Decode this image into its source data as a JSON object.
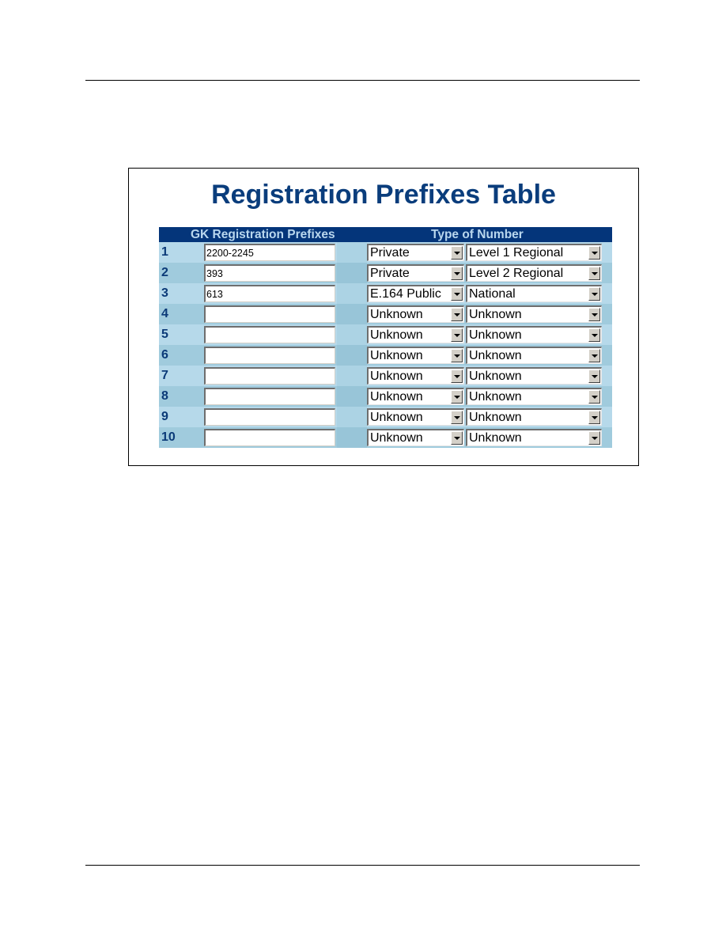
{
  "page": {
    "title": "Registration Prefixes Table",
    "table": {
      "headers": {
        "prefix": "GK Registration Prefixes",
        "type": "Type of Number"
      },
      "rows": [
        {
          "num": "1",
          "prefix": "2200-2245",
          "type": "Private",
          "plan": "Level 1 Regional"
        },
        {
          "num": "2",
          "prefix": "393",
          "type": "Private",
          "plan": "Level 2 Regional"
        },
        {
          "num": "3",
          "prefix": "613",
          "type": "E.164 Public",
          "plan": "National"
        },
        {
          "num": "4",
          "prefix": "",
          "type": "Unknown",
          "plan": "Unknown"
        },
        {
          "num": "5",
          "prefix": "",
          "type": "Unknown",
          "plan": "Unknown"
        },
        {
          "num": "6",
          "prefix": "",
          "type": "Unknown",
          "plan": "Unknown"
        },
        {
          "num": "7",
          "prefix": "",
          "type": "Unknown",
          "plan": "Unknown"
        },
        {
          "num": "8",
          "prefix": "",
          "type": "Unknown",
          "plan": "Unknown"
        },
        {
          "num": "9",
          "prefix": "",
          "type": "Unknown",
          "plan": "Unknown"
        },
        {
          "num": "10",
          "prefix": "",
          "type": "Unknown",
          "plan": "Unknown"
        }
      ]
    }
  },
  "colors": {
    "title": "#0a3d7c",
    "header_bg": "#04357a",
    "header_text": "#b9d7ee",
    "row_light": "#b6d9ea",
    "row_dark": "#a0cbdd"
  },
  "icons": {
    "dropdown": "chevron-down-icon"
  }
}
